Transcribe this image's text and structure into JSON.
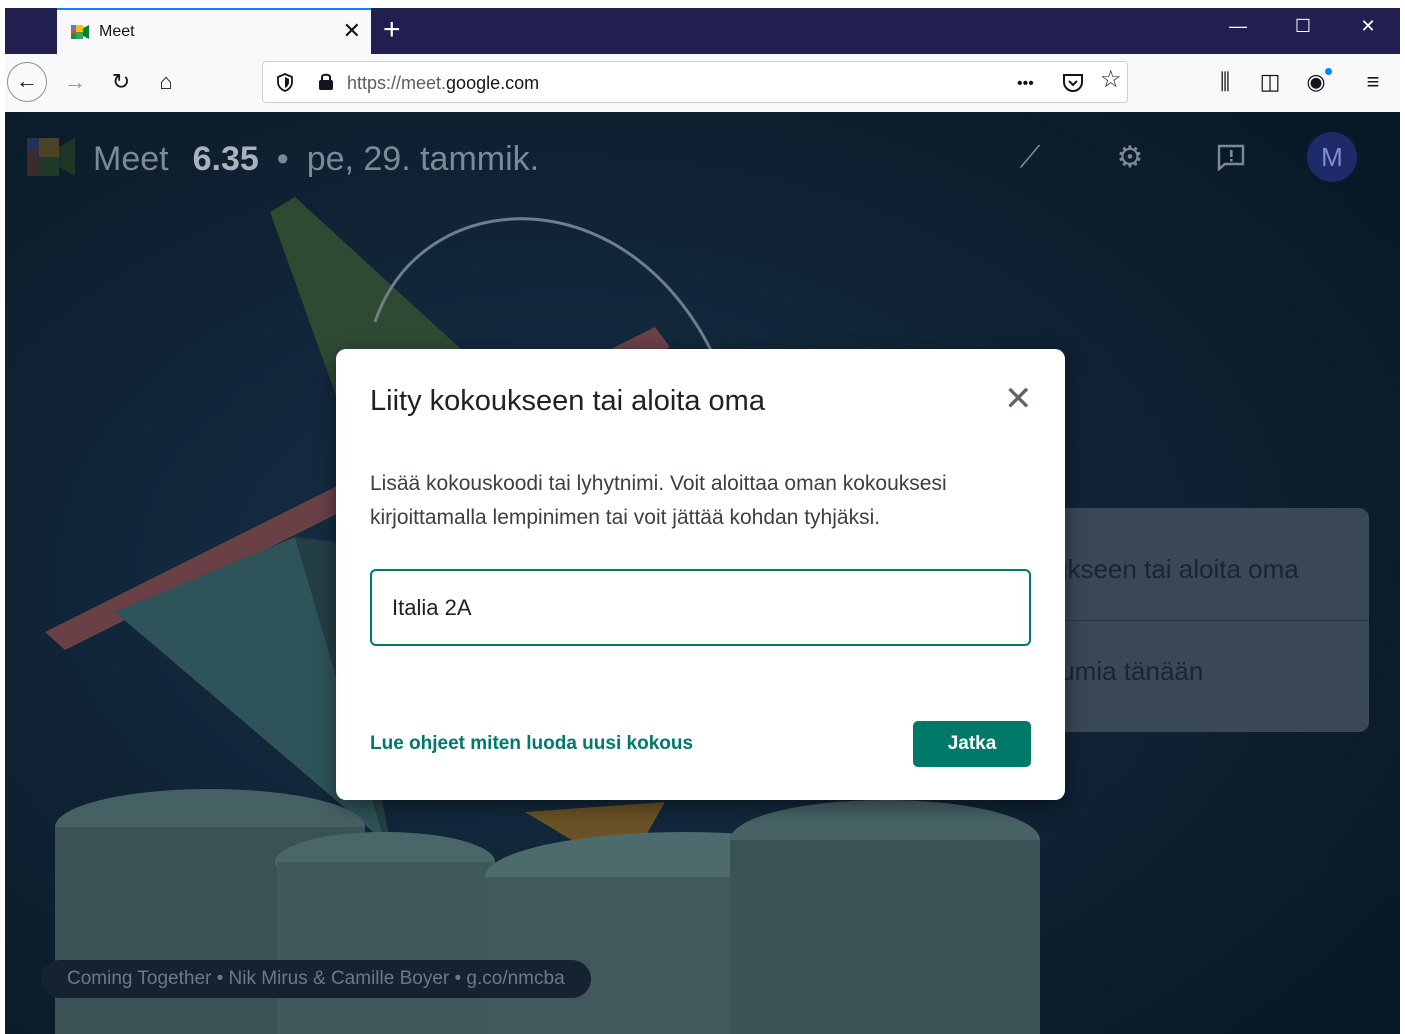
{
  "browser": {
    "tab": {
      "title": "Meet",
      "close": "✕"
    },
    "new_tab": "+",
    "window_controls": {
      "minimize": "—",
      "maximize": "☐",
      "close": "✕"
    },
    "nav": {
      "back": "←",
      "forward": "→",
      "reload": "↻",
      "home": "⌂"
    },
    "url": {
      "scheme": "https://meet.",
      "host": "google.com"
    },
    "url_icons": {
      "more": "•••",
      "pocket": "◡",
      "bookmark": "☆"
    },
    "right_icons": {
      "library": "⫼",
      "sidebar": "◫",
      "account": "◉",
      "menu": "≡"
    }
  },
  "meet": {
    "app_name": "Meet",
    "time": "6.35",
    "separator": "•",
    "date": "pe, 29. tammik.",
    "avatar_letter": "M",
    "header_icons": {
      "activity": "⟋",
      "settings": "⚙",
      "feedback": "!"
    },
    "background_card": {
      "line1": "ukseen tai aloita oma",
      "line2": "tumia tänään"
    },
    "credit": "Coming Together  •  Nik Mirus & Camille Boyer  •  g.co/nmcba"
  },
  "dialog": {
    "title": "Liity kokoukseen tai aloita oma",
    "close": "✕",
    "description": "Lisää kokouskoodi tai lyhytnimi. Voit aloittaa oman kokouksesi kirjoittamalla lempinimen tai voit jättää kohdan tyhjäksi.",
    "input_value": "Italia 2A",
    "help_link": "Lue ohjeet miten luoda uusi kokous",
    "continue_button": "Jatka"
  },
  "colors": {
    "tabbar": "#201f4f",
    "page_bg": "#0b1c2c",
    "accent": "#00796b",
    "avatar_bg": "#1e2a6a"
  }
}
